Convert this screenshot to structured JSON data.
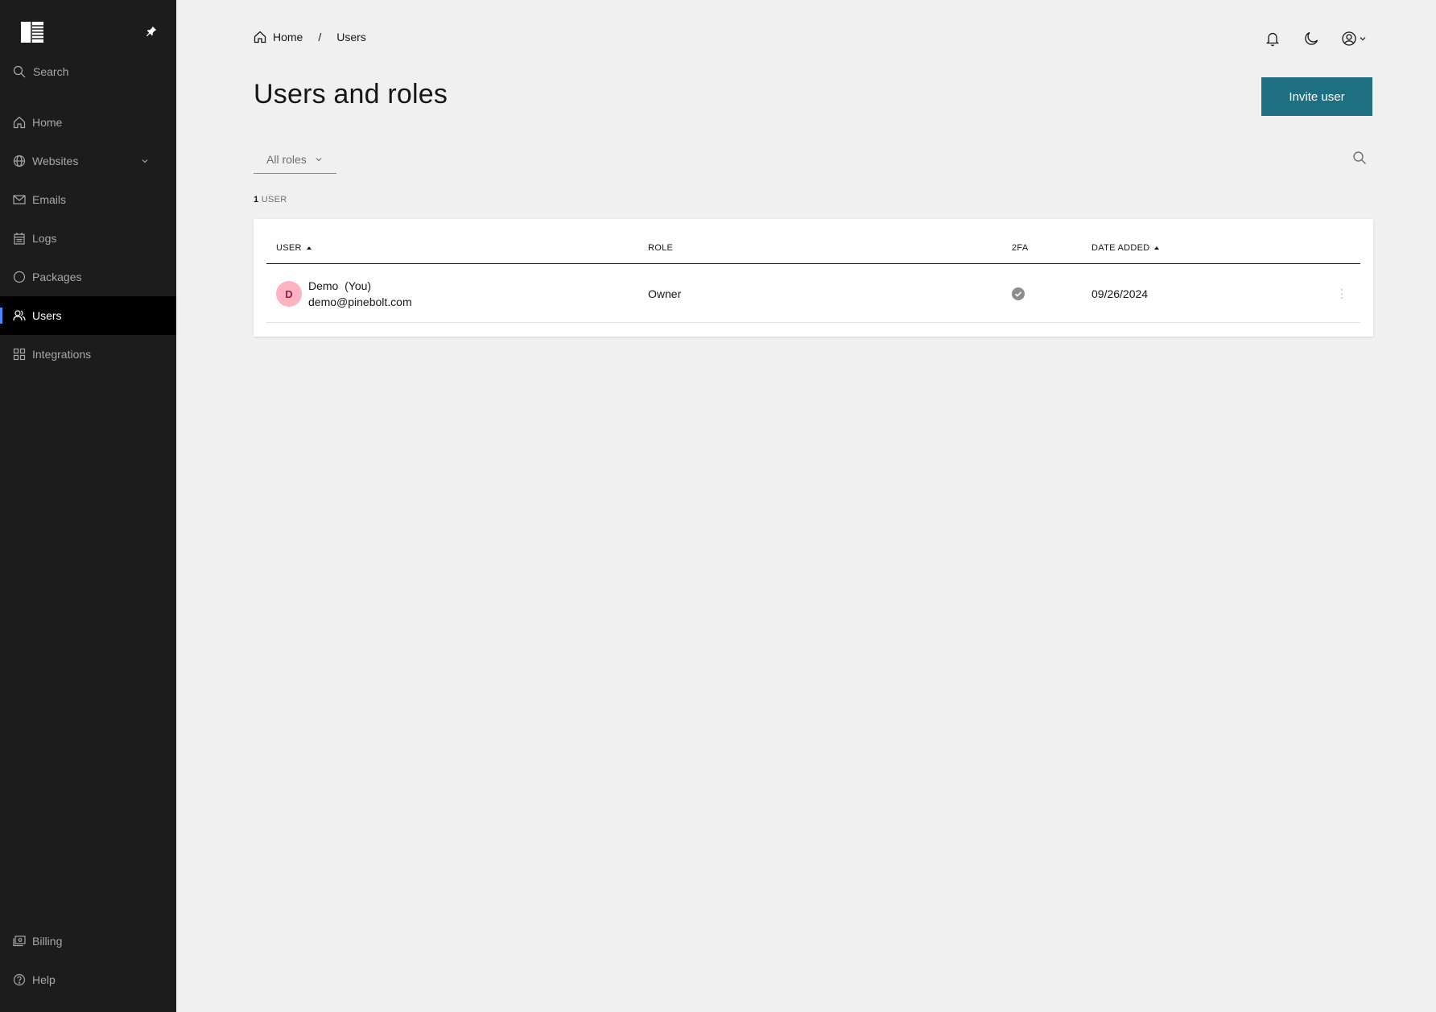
{
  "sidebar": {
    "search_label": "Search",
    "items": [
      {
        "label": "Home",
        "icon": "home-icon"
      },
      {
        "label": "Websites",
        "icon": "globe-icon"
      },
      {
        "label": "Emails",
        "icon": "mail-icon"
      },
      {
        "label": "Logs",
        "icon": "calendar-icon"
      },
      {
        "label": "Packages",
        "icon": "package-icon"
      },
      {
        "label": "Users",
        "icon": "users-icon",
        "active": true
      },
      {
        "label": "Integrations",
        "icon": "apps-icon"
      }
    ],
    "bottom_items": [
      {
        "label": "Billing",
        "icon": "billing-icon"
      },
      {
        "label": "Help",
        "icon": "help-icon"
      }
    ]
  },
  "breadcrumb": {
    "home": "Home",
    "separator": "/",
    "current": "Users"
  },
  "page": {
    "title": "Users and roles",
    "invite_label": "Invite user",
    "filter_label": "All roles",
    "count_number": "1",
    "count_label": "USER"
  },
  "table": {
    "columns": [
      "USER",
      "ROLE",
      "2FA",
      "DATE ADDED"
    ],
    "rows": [
      {
        "initial": "D",
        "name": "Demo  (You)",
        "email": "demo@pinebolt.com",
        "role": "Owner",
        "twofa": "enabled",
        "date_added": "09/26/2024"
      }
    ]
  },
  "colors": {
    "accent": "#1f6f82",
    "sidebar_bg": "#1c1c1c",
    "active_indicator": "#4589ff",
    "avatar_bg": "#ffb3c1"
  }
}
